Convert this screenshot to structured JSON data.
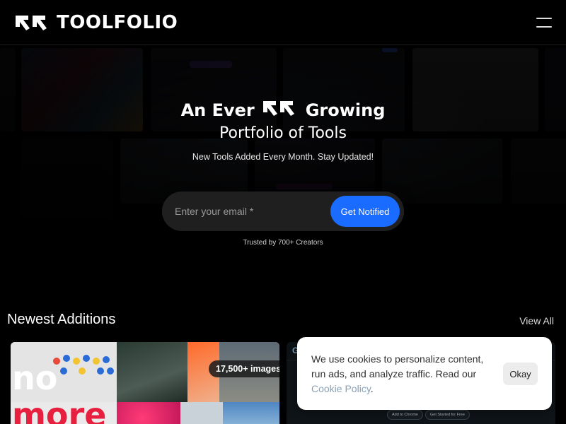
{
  "header": {
    "brand_name": "TOOLFOLIO",
    "logo_icon": "toolfolio-arrows-logo",
    "menu_icon": "hamburger-menu-icon"
  },
  "hero": {
    "title_before_logo": "An Ever",
    "title_after_logo": "Growing",
    "title_line2": "Portfolio of Tools",
    "subtitle": "New Tools Added Every Month. Stay Updated!",
    "email_placeholder": "Enter your email *",
    "email_value": "",
    "notify_button": "Get Notified",
    "trusted_text": "Trusted by 700+ Creators"
  },
  "newest": {
    "title": "Newest Additions",
    "view_all": "View All",
    "cards": [
      {
        "word1": "no",
        "word2": "more",
        "badge": "17,500+ images"
      },
      {
        "partial_label": "G",
        "pill1": "Add to Chrome",
        "pill2": "Get Started for Free"
      }
    ]
  },
  "cookie": {
    "text_before_link": "We use cookies to personalize content, run ads, and analyze traffic. Read our",
    "link_text": "Cookie Policy",
    "text_after_link": ".",
    "button": "Okay"
  },
  "colors": {
    "background": "#000000",
    "accent_blue": "#1a6bff",
    "cookie_link": "#8aa1b5",
    "more_red": "#e8203f"
  }
}
